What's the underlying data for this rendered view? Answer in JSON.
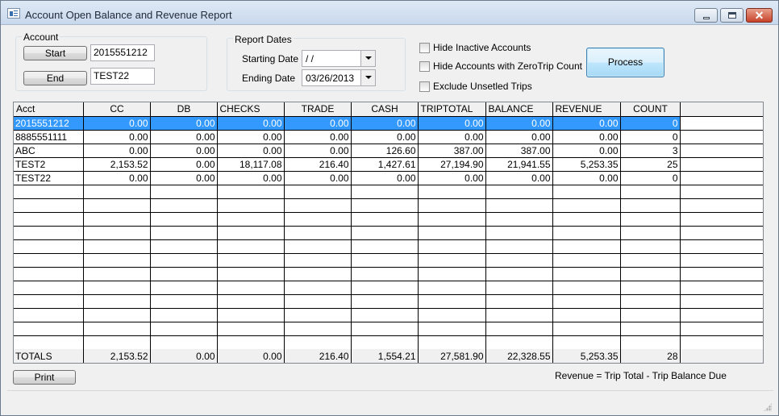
{
  "window": {
    "title": "Account Open Balance and Revenue Report",
    "controls": {
      "minimize": "minimize",
      "maximize": "maximize",
      "close": "✕"
    }
  },
  "account_group": {
    "label": "Account",
    "start_button": "Start",
    "start_value": "2015551212",
    "end_button": "End",
    "end_value": "TEST22"
  },
  "report_dates": {
    "label": "Report Dates",
    "starting_label": "Starting Date",
    "starting_value": " / /",
    "ending_label": "Ending Date",
    "ending_value": "03/26/2013"
  },
  "options": {
    "hide_inactive": {
      "label": "Hide Inactive Accounts",
      "checked": false
    },
    "hide_zero_trip": {
      "label": "Hide Accounts with ZeroTrip Count",
      "checked": false
    },
    "exclude_unsetled": {
      "label": "Exclude Unsetled Trips",
      "checked": false
    }
  },
  "process_button": "Process",
  "grid": {
    "columns": [
      "Acct",
      "CC",
      "DB",
      "CHECKS",
      "TRADE",
      "CASH",
      "TRIPTOTAL",
      "BALANCE",
      "REVENUE",
      "COUNT"
    ],
    "selected_row": 0,
    "rows": [
      [
        "2015551212",
        "0.00",
        "0.00",
        "0.00",
        "0.00",
        "0.00",
        "0.00",
        "0.00",
        "0.00",
        "0"
      ],
      [
        "8885551111",
        "0.00",
        "0.00",
        "0.00",
        "0.00",
        "0.00",
        "0.00",
        "0.00",
        "0.00",
        "0"
      ],
      [
        "ABC",
        "0.00",
        "0.00",
        "0.00",
        "0.00",
        "126.60",
        "387.00",
        "387.00",
        "0.00",
        "3"
      ],
      [
        "TEST2",
        "2,153.52",
        "0.00",
        "18,117.08",
        "216.40",
        "1,427.61",
        "27,194.90",
        "21,941.55",
        "5,253.35",
        "25"
      ],
      [
        "TEST22",
        "0.00",
        "0.00",
        "0.00",
        "0.00",
        "0.00",
        "0.00",
        "0.00",
        "0.00",
        "0"
      ]
    ],
    "empty_rows": 12,
    "totals": [
      "TOTALS",
      "2,153.52",
      "0.00",
      "0.00",
      "216.40",
      "1,554.21",
      "27,581.90",
      "22,328.55",
      "5,253.35",
      "28"
    ]
  },
  "print_button": "Print",
  "note": "Revenue = Trip Total - Trip Balance Due",
  "colors": {
    "selection": "#3399ff",
    "accent_button": "#a7d9f5"
  }
}
